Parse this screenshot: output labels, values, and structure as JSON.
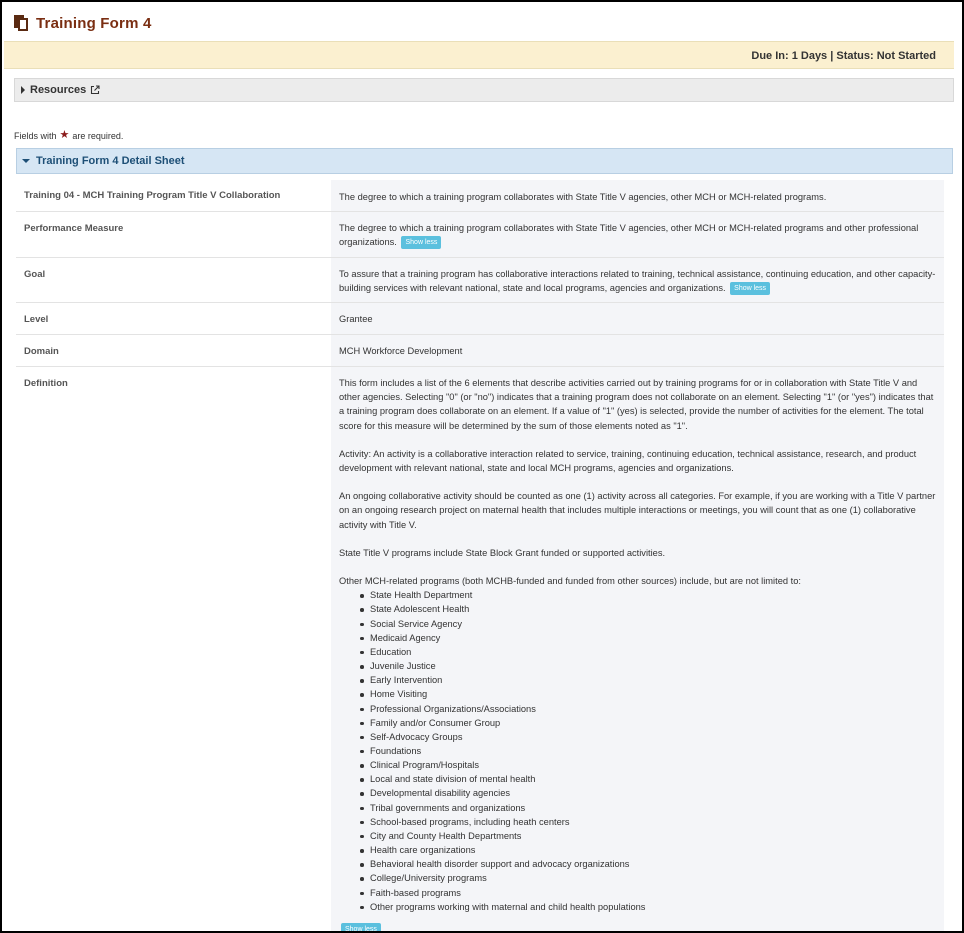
{
  "header": {
    "title": "Training Form 4"
  },
  "status_bar": {
    "text": "Due In: 1 Days | Status: Not Started"
  },
  "resources": {
    "label": "Resources"
  },
  "required_note": {
    "prefix": "Fields with",
    "suffix": "are required."
  },
  "section": {
    "title": "Training Form 4 Detail Sheet"
  },
  "show_less_label": "Show less",
  "details": {
    "training": {
      "label": "Training 04 - MCH Training Program Title V Collaboration",
      "value": "The degree to which a training program collaborates with State Title V agencies, other MCH or MCH-related programs."
    },
    "performance": {
      "label": "Performance Measure",
      "value": "The degree to which a training program collaborates with State Title V agencies, other MCH or MCH-related programs and other professional organizations."
    },
    "goal": {
      "label": "Goal",
      "value": "To assure that a training program has collaborative interactions related to training, technical assistance, continuing education, and other capacity-building services with relevant national, state and local programs, agencies and organizations."
    },
    "level": {
      "label": "Level",
      "value": "Grantee"
    },
    "domain": {
      "label": "Domain",
      "value": "MCH Workforce Development"
    },
    "definition": {
      "label": "Definition",
      "paragraphs": [
        "This form includes a list of the 6 elements that describe activities carried out by training programs for or in collaboration with State Title V and other agencies. Selecting \"0\" (or \"no\") indicates that a training program does not collaborate on an element. Selecting \"1\" (or \"yes\") indicates that a training program does collaborate on an element. If a value of \"1\" (yes) is selected, provide the number of activities for the element. The total score for this measure will be determined by the sum of those elements noted as \"1\".",
        "Activity: An activity is a collaborative interaction related to service, training, continuing education, technical assistance, research, and product development with relevant national, state and local MCH programs, agencies and organizations.",
        "An ongoing collaborative activity should be counted as one (1) activity across all categories. For example, if you are working with a Title V partner on an ongoing research project on maternal health that includes multiple interactions or meetings, you will count that as one (1) collaborative activity with Title V.",
        "State Title V programs include State Block Grant funded or supported activities.",
        "Other MCH-related programs (both MCHB-funded and funded from other sources) include, but are not limited to:"
      ],
      "list": [
        "State Health Department",
        "State Adolescent Health",
        "Social Service Agency",
        "Medicaid Agency",
        "Education",
        "Juvenile Justice",
        "Early Intervention",
        "Home Visiting",
        "Professional Organizations/Associations",
        "Family and/or Consumer Group",
        "Self-Advocacy Groups",
        "Foundations",
        "Clinical Program/Hospitals",
        "Local and state division of mental health",
        "Developmental disability agencies",
        "Tribal governments and organizations",
        "School-based programs, including heath centers",
        "City and County Health Departments",
        "Health care organizations",
        "Behavioral health disorder support and advocacy organizations",
        "College/University programs",
        "Faith-based programs",
        "Other programs working with maternal and child health populations"
      ]
    }
  }
}
